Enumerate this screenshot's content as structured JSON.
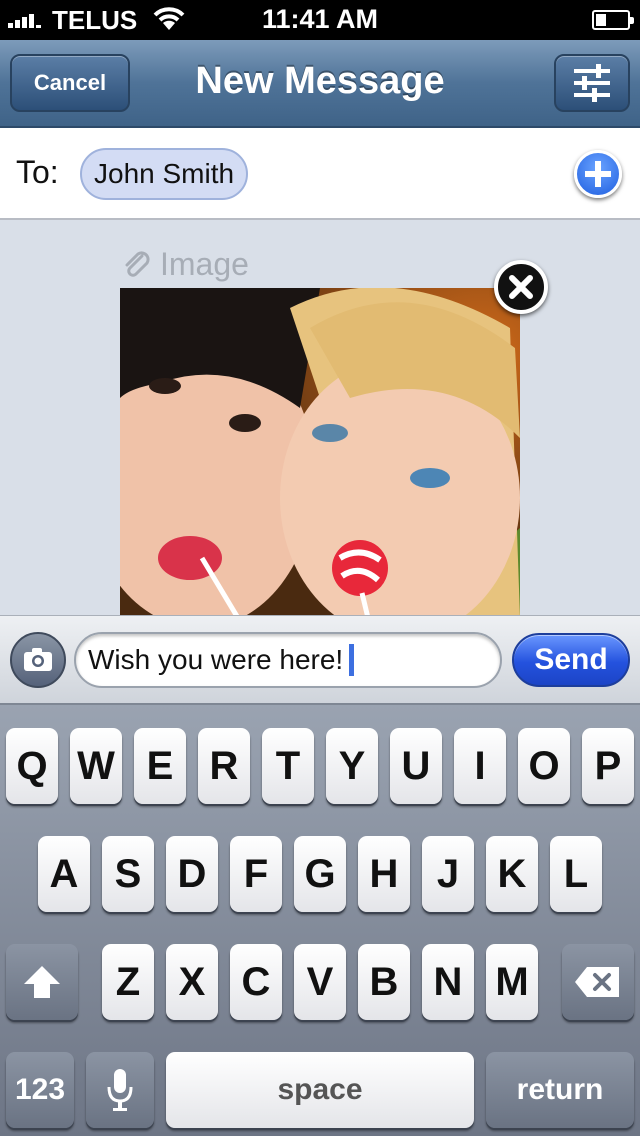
{
  "status_bar": {
    "carrier": "TELUS",
    "time": "11:41 AM"
  },
  "nav": {
    "cancel_label": "Cancel",
    "title": "New Message"
  },
  "to_row": {
    "label": "To:",
    "recipient": "John Smith"
  },
  "attachment": {
    "label": "Image"
  },
  "compose": {
    "message": "Wish you were here!",
    "send_label": "Send"
  },
  "keyboard": {
    "row1": [
      "Q",
      "W",
      "E",
      "R",
      "T",
      "Y",
      "U",
      "I",
      "O",
      "P"
    ],
    "row2": [
      "A",
      "S",
      "D",
      "F",
      "G",
      "H",
      "J",
      "K",
      "L"
    ],
    "row3": [
      "Z",
      "X",
      "C",
      "V",
      "B",
      "N",
      "M"
    ],
    "numbers_label": "123",
    "space_label": "space",
    "return_label": "return"
  },
  "colors": {
    "nav_blue": "#4f7398",
    "send_blue": "#2452de",
    "recipient_bubble": "#d3dcf4"
  }
}
